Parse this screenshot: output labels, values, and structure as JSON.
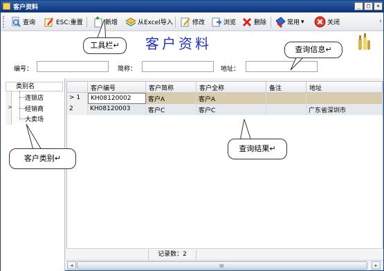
{
  "window": {
    "title": "客户资料",
    "controls": [
      "_",
      "□",
      "×"
    ]
  },
  "toolbar": {
    "query": "查询",
    "reset": "ESC:重置",
    "add": "新增",
    "import_excel": "从Excel导入",
    "edit": "修改",
    "browse": "浏览",
    "delete": "删除",
    "common": "常用",
    "common_arrow": "▾",
    "close": "关闭",
    "overflow": "›"
  },
  "header": {
    "title": "客户资料"
  },
  "search": {
    "code_label": "编号：",
    "short_label": "简称：",
    "address_label": "地址：",
    "code_value": "",
    "short_value": "",
    "address_value": ""
  },
  "category_tree": {
    "header": "类别名",
    "items": [
      "连锁店",
      "经销商",
      "大卖场"
    ]
  },
  "grid": {
    "columns": [
      "客户编号",
      "客户简称",
      "客户全称",
      "备注",
      "地址"
    ],
    "rows": [
      {
        "index": "1",
        "marker": ">",
        "code": "KH08120002",
        "short": "客户A",
        "full": "客户A",
        "note": "",
        "address": ""
      },
      {
        "index": "2",
        "marker": "",
        "code": "KH08120003",
        "short": "客户C",
        "full": "客户C",
        "note": "",
        "address": "广东省深圳市"
      }
    ],
    "record_count": "记录数：2"
  },
  "scrollbar": {
    "left": "◂",
    "right": "▸",
    "grip": "III"
  },
  "callouts": {
    "toolbar": "工具栏↵",
    "query_info": "查询信息↵",
    "category": "客户类别↵",
    "result": "查询结果↵"
  }
}
